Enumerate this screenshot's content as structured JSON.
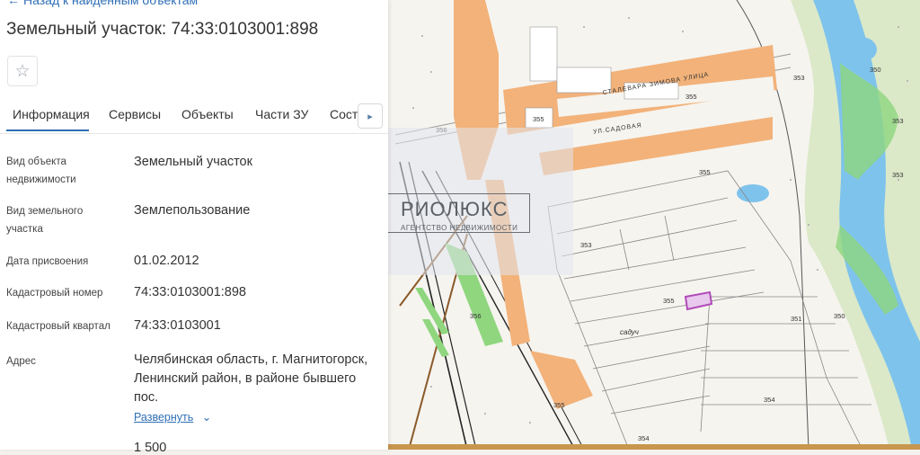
{
  "panel": {
    "back_link": "Назад к найденным объектам",
    "title": "Земельный участок: 74:33:0103001:898",
    "tabs": [
      "Информация",
      "Сервисы",
      "Объекты",
      "Части ЗУ",
      "Соста"
    ],
    "rows": [
      {
        "label": "Вид объекта недвижимости",
        "value": "Земельный участок"
      },
      {
        "label": "Вид земельного участка",
        "value": "Землепользование"
      },
      {
        "label": "Дата присвоения",
        "value": "01.02.2012"
      },
      {
        "label": "Кадастровый номер",
        "value": "74:33:0103001:898"
      },
      {
        "label": "Кадастровый квартал",
        "value": "74:33:0103001"
      },
      {
        "label": "Адрес",
        "value": "Челябинская область, г. Магнитогорск, Ленинский район, в районе бывшего пос."
      }
    ],
    "expand_label": "Развернуть",
    "cut_value": "1 500"
  },
  "watermark": {
    "name": "РИОЛЮКС",
    "tagline": "АГЕНТСТВО НЕДВИЖИМОСТИ"
  },
  "map": {
    "streets": [
      "СТАЛЕВАРА ЗИМОВА УЛИЦА",
      "УЛ.САДОВАЯ"
    ],
    "area_label": "садуч",
    "elevations": [
      "353",
      "350",
      "355",
      "355",
      "355",
      "356",
      "355",
      "351",
      "353",
      "356",
      "354",
      "355",
      "354",
      "350",
      "353",
      "353"
    ]
  },
  "colors": {
    "accent": "#2f6fb5",
    "buildings": "#f2b27a",
    "water": "#7ec3ec",
    "green": "#7fcf7a",
    "highlight": "#b04bb8"
  }
}
